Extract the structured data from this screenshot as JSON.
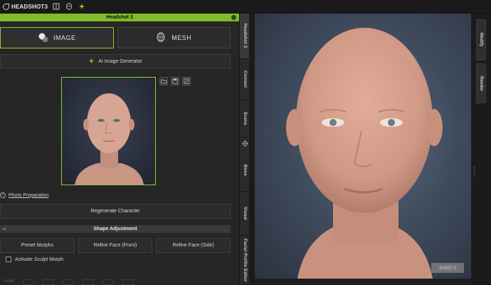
{
  "app": {
    "logo_text": "HEADSHOT3",
    "accent": "#8fcf2f"
  },
  "toolbar": {
    "icons": [
      "book-icon",
      "alien-head-icon",
      "sparkle-icon"
    ]
  },
  "panel": {
    "title": "Headshot 3",
    "modes": [
      {
        "label": "IMAGE",
        "icon": "face-scan-icon",
        "active": true
      },
      {
        "label": "MESH",
        "icon": "mesh-head-icon",
        "active": false
      }
    ],
    "ai_generator_label": "AI Image Generator",
    "image_actions": [
      "open-folder-icon",
      "save-icon",
      "crop-icon"
    ],
    "photo_preparation_label": "Photo Preparation",
    "regenerate_label": "Regenerate Character",
    "section_title": "Shape Adjustment",
    "section_collapse": "–",
    "refine_buttons": [
      "Preset Morphs",
      "Refine Face (Front)",
      "Refine Face (Side)"
    ],
    "sculpt_label": "Activate Sculpt Morph",
    "sculpt_tool_first": "Point"
  },
  "side_tabs": [
    "Headshot 3",
    "Content",
    "Scene",
    "Bone",
    "Visual",
    "Facial Profile Editor"
  ],
  "viewport": {
    "subd_label": "SubD 0"
  },
  "right_tabs": [
    "Modify",
    "Render"
  ]
}
